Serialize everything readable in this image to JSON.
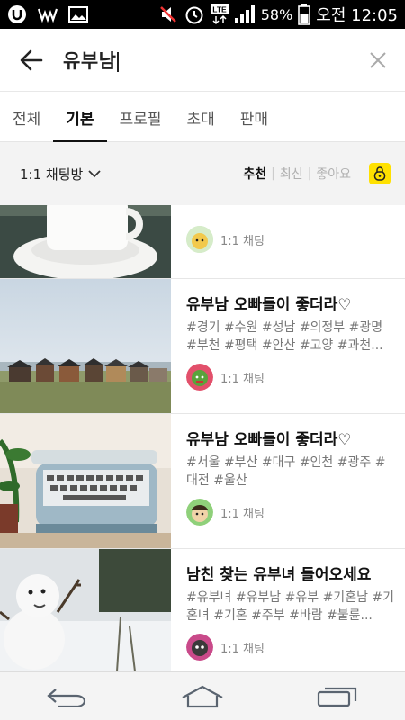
{
  "status": {
    "battery": "58%",
    "time": "오전 12:05",
    "network": "LTE",
    "icons": [
      "u-app-icon",
      "w-app-icon",
      "gallery-icon",
      "mute-icon",
      "alarm-icon",
      "lte-icon",
      "signal-icon",
      "battery-icon"
    ]
  },
  "search": {
    "query": "유부남"
  },
  "tabs": [
    {
      "label": "전체",
      "active": false
    },
    {
      "label": "기본",
      "active": true
    },
    {
      "label": "프로필",
      "active": false
    },
    {
      "label": "초대",
      "active": false
    },
    {
      "label": "판매",
      "active": false
    }
  ],
  "filter": {
    "room_type": "1:1 채팅방",
    "sorts": [
      {
        "label": "추천",
        "active": true
      },
      {
        "label": "최신",
        "active": false
      },
      {
        "label": "좋아요",
        "active": false
      }
    ]
  },
  "results": [
    {
      "title": "",
      "tags": "",
      "chat_label": "1:1 채팅",
      "thumbnail": "coffee-cup",
      "avatar": "yellow-character"
    },
    {
      "title": "유부남 오빠들이 좋더라♡",
      "tags": "#경기 #수원 #성남 #의정부 #광명 #부천 #평택 #안산 #고양 #과천...",
      "chat_label": "1:1 채팅",
      "thumbnail": "beach-huts",
      "avatar": "green-character"
    },
    {
      "title": "유부남 오빠들이 좋더라♡",
      "tags": "#서울 #부산 #대구 #인천 #광주 #대전 #울산",
      "chat_label": "1:1 채팅",
      "thumbnail": "typewriter",
      "avatar": "green-character-2"
    },
    {
      "title": "남친 찾는 유부녀 들어오세요",
      "tags": "#유부녀 #유부남 #유부 #기혼남 #기혼녀 #기혼 #주부 #바람 #불륜...",
      "chat_label": "1:1 채팅",
      "thumbnail": "snowman",
      "avatar": "purple-character"
    }
  ],
  "nav": [
    "back-nav-icon",
    "home-nav-icon",
    "recent-apps-icon"
  ]
}
